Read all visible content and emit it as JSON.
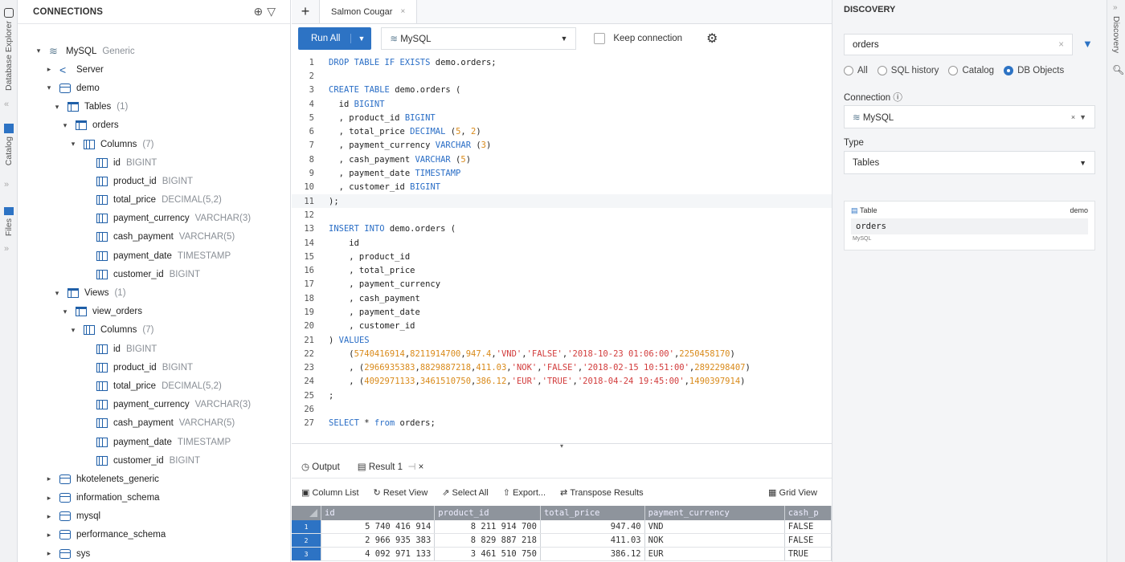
{
  "left_strip": {
    "database_explorer": "Database Explorer",
    "catalog": "Catalog",
    "files": "Files"
  },
  "connections": {
    "title": "CONNECTIONS",
    "tree": [
      {
        "depth": 0,
        "arrow": "▾",
        "icon": "my",
        "name": "MySQL",
        "type": "Generic"
      },
      {
        "depth": 1,
        "arrow": "▸",
        "icon": "srv",
        "name": "Server",
        "type": ""
      },
      {
        "depth": 1,
        "arrow": "▾",
        "icon": "db",
        "name": "demo",
        "type": ""
      },
      {
        "depth": 2,
        "arrow": "▾",
        "icon": "tbl",
        "name": "Tables",
        "type": "(1)"
      },
      {
        "depth": 3,
        "arrow": "▾",
        "icon": "tbl",
        "name": "orders",
        "type": ""
      },
      {
        "depth": 4,
        "arrow": "▾",
        "icon": "col",
        "name": "Columns",
        "type": "(7)"
      },
      {
        "depth": 5,
        "arrow": "",
        "icon": "col",
        "name": "id",
        "type": "BIGINT"
      },
      {
        "depth": 5,
        "arrow": "",
        "icon": "col",
        "name": "product_id",
        "type": "BIGINT"
      },
      {
        "depth": 5,
        "arrow": "",
        "icon": "col",
        "name": "total_price",
        "type": "DECIMAL(5,2)"
      },
      {
        "depth": 5,
        "arrow": "",
        "icon": "col",
        "name": "payment_currency",
        "type": "VARCHAR(3)"
      },
      {
        "depth": 5,
        "arrow": "",
        "icon": "col",
        "name": "cash_payment",
        "type": "VARCHAR(5)"
      },
      {
        "depth": 5,
        "arrow": "",
        "icon": "col",
        "name": "payment_date",
        "type": "TIMESTAMP"
      },
      {
        "depth": 5,
        "arrow": "",
        "icon": "col",
        "name": "customer_id",
        "type": "BIGINT"
      },
      {
        "depth": 2,
        "arrow": "▾",
        "icon": "tbl",
        "name": "Views",
        "type": "(1)"
      },
      {
        "depth": 3,
        "arrow": "▾",
        "icon": "tbl",
        "name": "view_orders",
        "type": ""
      },
      {
        "depth": 4,
        "arrow": "▾",
        "icon": "col",
        "name": "Columns",
        "type": "(7)"
      },
      {
        "depth": 5,
        "arrow": "",
        "icon": "col",
        "name": "id",
        "type": "BIGINT"
      },
      {
        "depth": 5,
        "arrow": "",
        "icon": "col",
        "name": "product_id",
        "type": "BIGINT"
      },
      {
        "depth": 5,
        "arrow": "",
        "icon": "col",
        "name": "total_price",
        "type": "DECIMAL(5,2)"
      },
      {
        "depth": 5,
        "arrow": "",
        "icon": "col",
        "name": "payment_currency",
        "type": "VARCHAR(3)"
      },
      {
        "depth": 5,
        "arrow": "",
        "icon": "col",
        "name": "cash_payment",
        "type": "VARCHAR(5)"
      },
      {
        "depth": 5,
        "arrow": "",
        "icon": "col",
        "name": "payment_date",
        "type": "TIMESTAMP"
      },
      {
        "depth": 5,
        "arrow": "",
        "icon": "col",
        "name": "customer_id",
        "type": "BIGINT"
      },
      {
        "depth": 1,
        "arrow": "▸",
        "icon": "db",
        "name": "hkotelenets_generic",
        "type": ""
      },
      {
        "depth": 1,
        "arrow": "▸",
        "icon": "db",
        "name": "information_schema",
        "type": ""
      },
      {
        "depth": 1,
        "arrow": "▸",
        "icon": "db",
        "name": "mysql",
        "type": ""
      },
      {
        "depth": 1,
        "arrow": "▸",
        "icon": "db",
        "name": "performance_schema",
        "type": ""
      },
      {
        "depth": 1,
        "arrow": "▸",
        "icon": "db",
        "name": "sys",
        "type": ""
      }
    ]
  },
  "editor": {
    "tab": "Salmon Cougar",
    "run_all": "Run All",
    "db_select": "MySQL",
    "keep_connection": "Keep connection",
    "lines": [
      [
        [
          "kw",
          "DROP TABLE IF EXISTS "
        ],
        [
          "t",
          "demo.orders;"
        ]
      ],
      [],
      [
        [
          "kw",
          "CREATE TABLE "
        ],
        [
          "t",
          "demo.orders ("
        ]
      ],
      [
        [
          "t",
          "  id "
        ],
        [
          "kw",
          "BIGINT"
        ]
      ],
      [
        [
          "t",
          "  , product_id "
        ],
        [
          "kw",
          "BIGINT"
        ]
      ],
      [
        [
          "t",
          "  , total_price "
        ],
        [
          "kw",
          "DECIMAL "
        ],
        [
          "t",
          "("
        ],
        [
          "num",
          "5"
        ],
        [
          "t",
          ", "
        ],
        [
          "num",
          "2"
        ],
        [
          "t",
          ")"
        ]
      ],
      [
        [
          "t",
          "  , payment_currency "
        ],
        [
          "kw",
          "VARCHAR "
        ],
        [
          "t",
          "("
        ],
        [
          "num",
          "3"
        ],
        [
          "t",
          ")"
        ]
      ],
      [
        [
          "t",
          "  , cash_payment "
        ],
        [
          "kw",
          "VARCHAR "
        ],
        [
          "t",
          "("
        ],
        [
          "num",
          "5"
        ],
        [
          "t",
          ")"
        ]
      ],
      [
        [
          "t",
          "  , payment_date "
        ],
        [
          "kw",
          "TIMESTAMP"
        ]
      ],
      [
        [
          "t",
          "  , customer_id "
        ],
        [
          "kw",
          "BIGINT"
        ]
      ],
      [
        [
          "t",
          ");"
        ]
      ],
      [],
      [
        [
          "kw",
          "INSERT INTO "
        ],
        [
          "t",
          "demo.orders ("
        ]
      ],
      [
        [
          "t",
          "    id"
        ]
      ],
      [
        [
          "t",
          "    , product_id"
        ]
      ],
      [
        [
          "t",
          "    , total_price"
        ]
      ],
      [
        [
          "t",
          "    , payment_currency"
        ]
      ],
      [
        [
          "t",
          "    , cash_payment"
        ]
      ],
      [
        [
          "t",
          "    , payment_date"
        ]
      ],
      [
        [
          "t",
          "    , customer_id"
        ]
      ],
      [
        [
          "t",
          ") "
        ],
        [
          "kw",
          "VALUES"
        ]
      ],
      [
        [
          "t",
          "    ("
        ],
        [
          "num",
          "5740416914"
        ],
        [
          "t",
          ","
        ],
        [
          "num",
          "8211914700"
        ],
        [
          "t",
          ","
        ],
        [
          "num",
          "947.4"
        ],
        [
          "t",
          ","
        ],
        [
          "str",
          "'VND'"
        ],
        [
          "t",
          ","
        ],
        [
          "str",
          "'FALSE'"
        ],
        [
          "t",
          ","
        ],
        [
          "str",
          "'2018-10-23 01:06:00'"
        ],
        [
          "t",
          ","
        ],
        [
          "num",
          "2250458170"
        ],
        [
          "t",
          ")"
        ]
      ],
      [
        [
          "t",
          "    , ("
        ],
        [
          "num",
          "2966935383"
        ],
        [
          "t",
          ","
        ],
        [
          "num",
          "8829887218"
        ],
        [
          "t",
          ","
        ],
        [
          "num",
          "411.03"
        ],
        [
          "t",
          ","
        ],
        [
          "str",
          "'NOK'"
        ],
        [
          "t",
          ","
        ],
        [
          "str",
          "'FALSE'"
        ],
        [
          "t",
          ","
        ],
        [
          "str",
          "'2018-02-15 10:51:00'"
        ],
        [
          "t",
          ","
        ],
        [
          "num",
          "2892298407"
        ],
        [
          "t",
          ")"
        ]
      ],
      [
        [
          "t",
          "    , ("
        ],
        [
          "num",
          "4092971133"
        ],
        [
          "t",
          ","
        ],
        [
          "num",
          "3461510750"
        ],
        [
          "t",
          ","
        ],
        [
          "num",
          "386.12"
        ],
        [
          "t",
          ","
        ],
        [
          "str",
          "'EUR'"
        ],
        [
          "t",
          ","
        ],
        [
          "str",
          "'TRUE'"
        ],
        [
          "t",
          ","
        ],
        [
          "str",
          "'2018-04-24 19:45:00'"
        ],
        [
          "t",
          ","
        ],
        [
          "num",
          "1490397914"
        ],
        [
          "t",
          ")"
        ]
      ],
      [
        [
          "t",
          ";"
        ]
      ],
      [],
      [
        [
          "kw",
          "SELECT "
        ],
        [
          "t",
          "* "
        ],
        [
          "kw",
          "from "
        ],
        [
          "t",
          "orders;"
        ]
      ]
    ]
  },
  "results": {
    "output_tab": "Output",
    "result_tab": "Result 1",
    "toolbar": {
      "column_list": "Column List",
      "reset_view": "Reset View",
      "select_all": "Select All",
      "export": "Export...",
      "transpose": "Transpose Results",
      "grid_view": "Grid View"
    },
    "columns": [
      "id",
      "product_id",
      "total_price",
      "payment_currency",
      "cash_p"
    ],
    "rows": [
      [
        "1",
        "5 740 416 914",
        "8 211 914 700",
        "947.40",
        "VND",
        "FALSE"
      ],
      [
        "2",
        "2 966 935 383",
        "8 829 887 218",
        "411.03",
        "NOK",
        "FALSE"
      ],
      [
        "3",
        "4 092 971 133",
        "3 461 510 750",
        "386.12",
        "EUR",
        "TRUE"
      ]
    ]
  },
  "discovery": {
    "title": "DISCOVERY",
    "search_value": "orders",
    "radios": [
      "All",
      "SQL history",
      "Catalog",
      "DB Objects"
    ],
    "selected_radio": "DB Objects",
    "connection_label": "Connection",
    "connection_value": "MySQL",
    "type_label": "Type",
    "type_value": "Tables",
    "card": {
      "kind": "Table",
      "schema": "demo",
      "name": "orders",
      "source": "MySQL"
    }
  },
  "right_strip": {
    "label": "Discovery"
  }
}
